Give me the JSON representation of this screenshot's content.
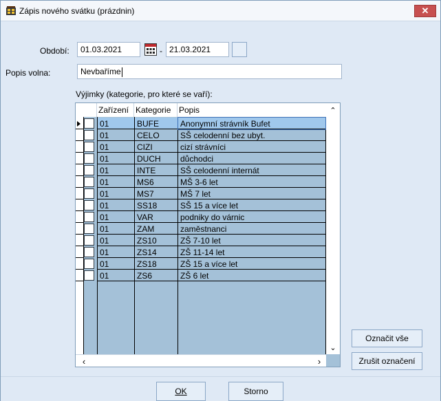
{
  "window": {
    "title": "Zápis nového svátku (prázdnin)",
    "close_glyph": "✕"
  },
  "form": {
    "period_label": "Období:",
    "date_from": "01.03.2021",
    "date_separator": "-",
    "date_to": "21.03.2021",
    "description_label": "Popis volna:",
    "description_value": "Nevbaříme"
  },
  "exceptions": {
    "caption": "Výjimky (kategorie, pro které se vaří):",
    "columns": [
      "Zařízení",
      "Kategorie",
      "Popis"
    ],
    "rows": [
      {
        "facility": "01",
        "category": "BUFE",
        "description": "Anonymní strávník Bufet",
        "checked": false,
        "selected": true
      },
      {
        "facility": "01",
        "category": "CELO",
        "description": "SŠ celodenní bez ubyt.",
        "checked": false
      },
      {
        "facility": "01",
        "category": "CIZI",
        "description": "cizí strávníci",
        "checked": false
      },
      {
        "facility": "01",
        "category": "DUCH",
        "description": "důchodci",
        "checked": false
      },
      {
        "facility": "01",
        "category": "INTE",
        "description": "SŠ celodenní internát",
        "checked": false
      },
      {
        "facility": "01",
        "category": "MS6",
        "description": "MŠ 3-6 let",
        "checked": false
      },
      {
        "facility": "01",
        "category": "MS7",
        "description": "MŠ 7 let",
        "checked": false
      },
      {
        "facility": "01",
        "category": "SS18",
        "description": "SŠ 15 a více let",
        "checked": false
      },
      {
        "facility": "01",
        "category": "VAR",
        "description": "podniky do várnic",
        "checked": false
      },
      {
        "facility": "01",
        "category": "ZAM",
        "description": "zaměstnanci",
        "checked": false
      },
      {
        "facility": "01",
        "category": "ZS10",
        "description": "ZŠ 7-10 let",
        "checked": false
      },
      {
        "facility": "01",
        "category": "ZS14",
        "description": "ZŠ 11-14 let",
        "checked": false
      },
      {
        "facility": "01",
        "category": "ZS18",
        "description": "ZŠ 15 a více let",
        "checked": false
      },
      {
        "facility": "01",
        "category": "ZS6",
        "description": "ZŠ 6 let",
        "checked": false
      }
    ]
  },
  "buttons": {
    "select_all": "Označit vše",
    "deselect_all": "Zrušit označení",
    "ok": "OK",
    "cancel": "Storno"
  },
  "colors": {
    "window_bg": "#dfe9f5",
    "grid_bg": "#a4c1d8",
    "selection": "#a0c8ec",
    "close": "#c75050"
  }
}
